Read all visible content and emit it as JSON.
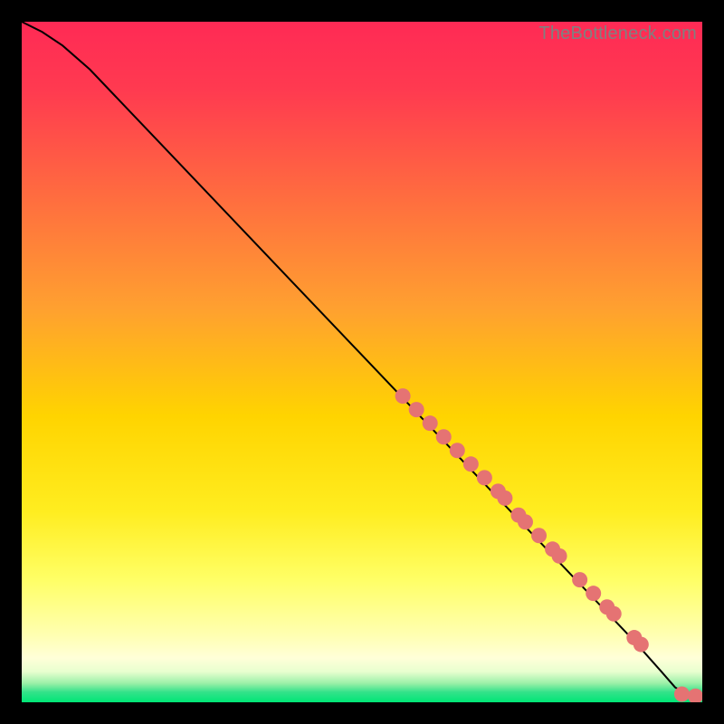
{
  "watermark": "TheBottleneck.com",
  "colors": {
    "gradient_top": "#ff2a55",
    "gradient_mid1": "#ff7a3c",
    "gradient_mid2": "#ffd400",
    "gradient_mid3": "#ffff66",
    "gradient_band": "#ffffcc",
    "gradient_bottom": "#00e676",
    "curve": "#000000",
    "marker": "#e57373"
  },
  "chart_data": {
    "type": "line",
    "title": "",
    "xlabel": "",
    "ylabel": "",
    "xlim": [
      0,
      100
    ],
    "ylim": [
      0,
      100
    ],
    "curve": {
      "x": [
        0,
        3,
        6,
        10,
        20,
        30,
        40,
        50,
        60,
        70,
        80,
        90,
        94,
        96,
        98,
        100
      ],
      "y": [
        100,
        98.5,
        96.5,
        93,
        82.5,
        72,
        61.5,
        51,
        40.5,
        30,
        19.5,
        9,
        4.5,
        2.2,
        1.0,
        0.8
      ]
    },
    "series": [
      {
        "name": "cluster",
        "x": [
          56,
          58,
          60,
          62,
          64,
          66,
          68,
          70,
          71,
          73,
          74,
          76,
          78,
          79,
          82,
          84,
          86,
          87,
          90,
          91,
          97,
          99
        ],
        "y": [
          45,
          43,
          41,
          39,
          37,
          35,
          33,
          31,
          30,
          27.5,
          26.5,
          24.5,
          22.5,
          21.5,
          18,
          16,
          14,
          13,
          9.5,
          8.5,
          1.2,
          0.9
        ]
      }
    ]
  }
}
